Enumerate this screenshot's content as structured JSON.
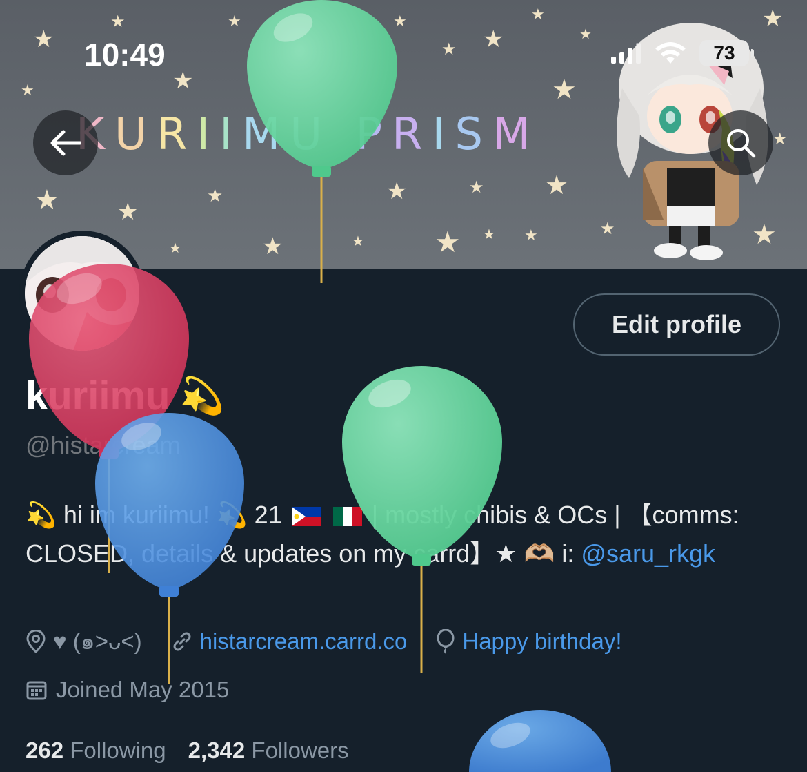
{
  "status_bar": {
    "time": "10:49",
    "battery": "73"
  },
  "banner": {
    "title_letters": [
      "K",
      "U",
      "R",
      "I",
      "I",
      "M",
      "U",
      " ",
      "P",
      "R",
      "I",
      "S",
      "M"
    ],
    "title_colors": [
      "#f0b8c8",
      "#f3d3a8",
      "#f6e6a6",
      "#cfe9a8",
      "#a8e3c8",
      "#a8d8ee",
      "#b0c8f0",
      "",
      "#b8b8f0",
      "#c8b0f0",
      "#a8d8ee",
      "#a8c8f0",
      "#d8a8e8"
    ]
  },
  "nav": {
    "back_icon": "arrow-left-icon",
    "search_icon": "search-icon"
  },
  "profile": {
    "edit_button": "Edit profile",
    "display_name": "kuriimu",
    "name_emoji": "💫",
    "handle": "@histarcream",
    "bio": {
      "part1": "💫 hi im kuriimu! 💫 21",
      "part2": "| mostly chibis & OCs | 【comms: CLOSED, details & updates on my carrd】★ 🫶🏼 i:",
      "mention": "@saru_rkgk"
    },
    "location": "♥ (๑˃ᴗ˂)",
    "website": "histarcream.carrd.co",
    "birthday": "Happy birthday!",
    "joined": "Joined May 2015",
    "following_count": "262",
    "following_label": "Following",
    "followers_count": "2,342",
    "followers_label": "Followers"
  },
  "colors": {
    "background": "#15202b",
    "link": "#4a99e9",
    "balloon_green": "#5fd39a",
    "balloon_red": "#d8385f",
    "balloon_blue": "#4a8fe0"
  }
}
